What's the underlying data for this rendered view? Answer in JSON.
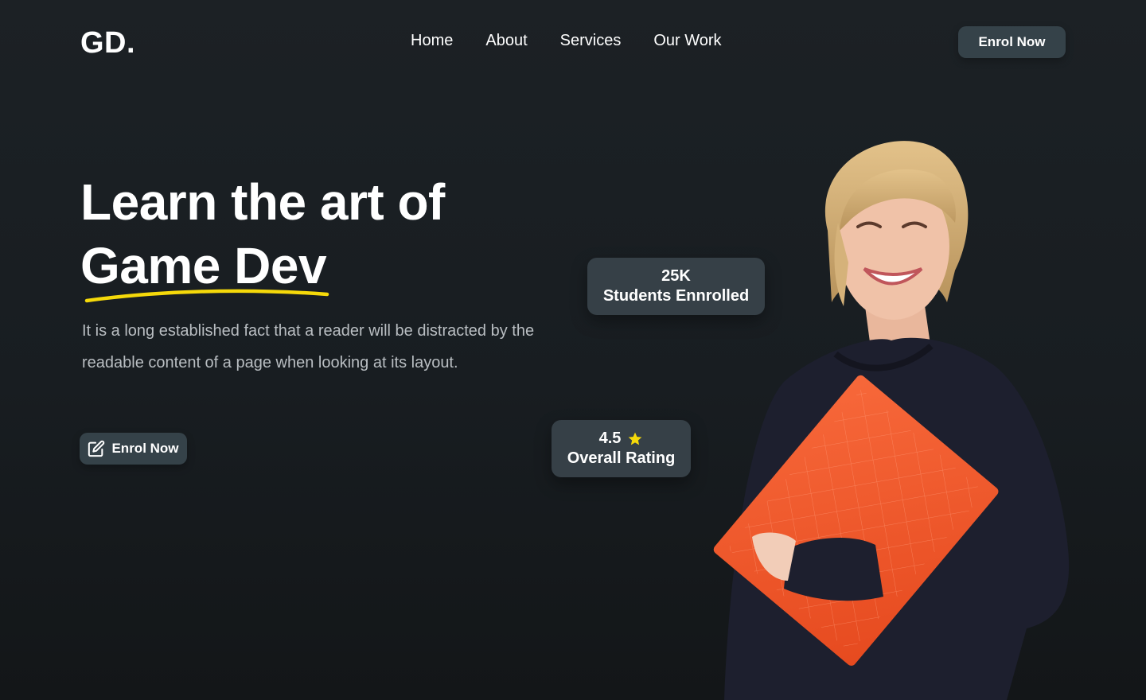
{
  "logo": "GD.",
  "nav": {
    "items": [
      "Home",
      "About",
      "Services",
      "Our Work"
    ]
  },
  "header": {
    "cta_label": "Enrol Now"
  },
  "hero": {
    "title_line1": "Learn the art of",
    "title_line2": "Game Dev",
    "description": "It is a long established fact that a reader will be distracted by the readable content of a page when looking at its layout.",
    "cta_label": "Enrol Now",
    "cta_icon": "edit-icon"
  },
  "stats": {
    "students": {
      "value": "25K",
      "label": "Students Ennrolled"
    },
    "rating": {
      "value": "4.5",
      "label": "Overall Rating",
      "icon": "star-icon"
    }
  },
  "colors": {
    "accent": "#f5d90a",
    "button_bg": "#354249",
    "card_bg": "#364047",
    "book": "#f0562a"
  }
}
